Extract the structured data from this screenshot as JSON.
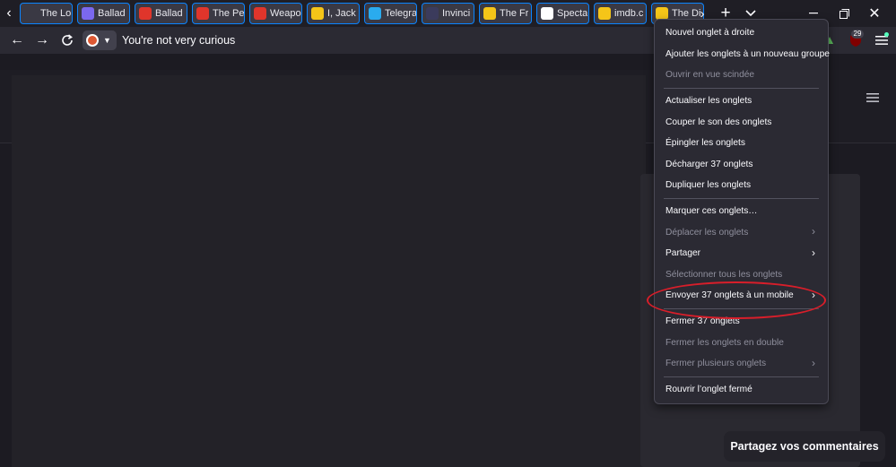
{
  "tabs": [
    {
      "label": "The Lo",
      "icon": "page-icon",
      "color": "#3a3944"
    },
    {
      "label": "Ballad",
      "icon": "film-icon",
      "color": "#7b68ee"
    },
    {
      "label": "Ballad",
      "icon": "tomato-icon",
      "color": "#e0352b"
    },
    {
      "label": "The Pe",
      "icon": "tomato-icon",
      "color": "#e0352b"
    },
    {
      "label": "Weapo",
      "icon": "tomato-icon",
      "color": "#e0352b"
    },
    {
      "label": "I, Jack",
      "icon": "imdb-icon",
      "color": "#f5c518"
    },
    {
      "label": "Telegra",
      "icon": "telegram-icon",
      "color": "#2aabee"
    },
    {
      "label": "Invinci",
      "icon": "video-icon",
      "color": "#3b3b5c"
    },
    {
      "label": "The Fr",
      "icon": "imdb-icon",
      "color": "#f5c518"
    },
    {
      "label": "Specta",
      "icon": "h-icon",
      "color": "#ffffff"
    },
    {
      "label": "imdb.c",
      "icon": "imdb-icon",
      "color": "#f5c518"
    },
    {
      "label": "The Di",
      "icon": "imdb-icon",
      "color": "#f5c518"
    }
  ],
  "toolbar": {
    "url_text": "You're not very curious",
    "extension_badge": "29"
  },
  "content": {
    "feedback_label": "Partagez vos commentaires"
  },
  "menu": {
    "items": [
      {
        "label": "Nouvel onglet à droite",
        "disabled": false,
        "submenu": false
      },
      {
        "label": "Ajouter les onglets à un nouveau groupe",
        "disabled": false,
        "submenu": false
      },
      {
        "label": "Ouvrir en vue scindée",
        "disabled": true,
        "submenu": false
      },
      {
        "sep": true
      },
      {
        "label": "Actualiser les onglets",
        "disabled": false,
        "submenu": false
      },
      {
        "label": "Couper le son des onglets",
        "disabled": false,
        "submenu": false
      },
      {
        "label": "Épingler les onglets",
        "disabled": false,
        "submenu": false
      },
      {
        "label": "Décharger 37 onglets",
        "disabled": false,
        "submenu": false
      },
      {
        "label": "Dupliquer les onglets",
        "disabled": false,
        "submenu": false
      },
      {
        "sep": true
      },
      {
        "label": "Marquer ces onglets…",
        "disabled": false,
        "submenu": false
      },
      {
        "label": "Déplacer les onglets",
        "disabled": true,
        "submenu": true
      },
      {
        "label": "Partager",
        "disabled": false,
        "submenu": true
      },
      {
        "label": "Sélectionner tous les onglets",
        "disabled": true,
        "submenu": false
      },
      {
        "label": "Envoyer 37 onglets à un mobile",
        "disabled": false,
        "submenu": true
      },
      {
        "sep": true
      },
      {
        "label": "Fermer 37 onglets",
        "disabled": false,
        "submenu": false
      },
      {
        "label": "Fermer les onglets en double",
        "disabled": true,
        "submenu": false
      },
      {
        "label": "Fermer plusieurs onglets",
        "disabled": true,
        "submenu": true
      },
      {
        "sep": true
      },
      {
        "label": "Rouvrir l’onglet fermé",
        "disabled": false,
        "submenu": false
      }
    ]
  }
}
